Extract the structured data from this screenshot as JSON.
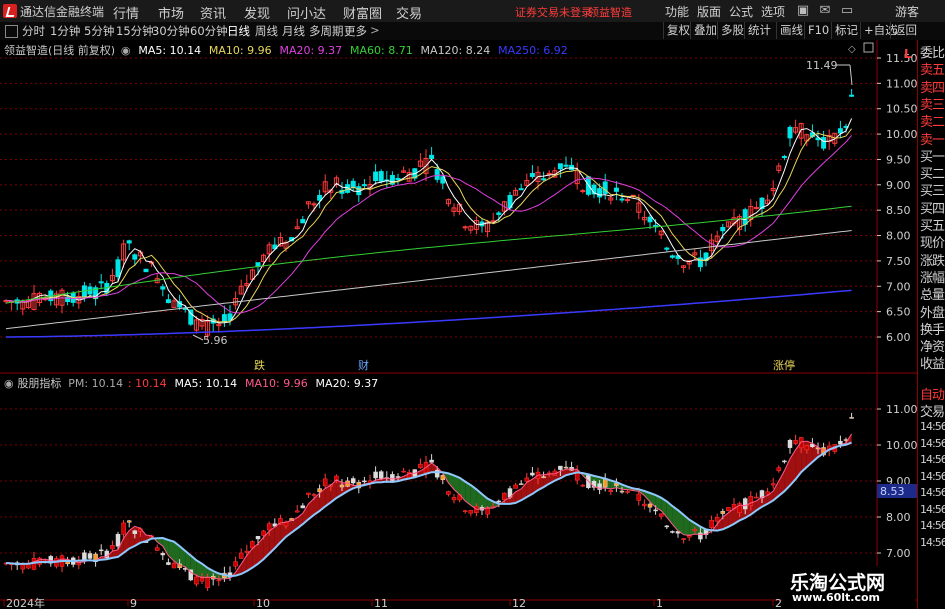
{
  "app": {
    "title": "通达信金融终端",
    "menu": [
      "行情",
      "市场",
      "资讯",
      "发现",
      "问小达",
      "财富圈",
      "交易"
    ],
    "warning": "证券交易未登录",
    "stock_link": "领益智造",
    "right_menu": [
      "功能",
      "版面",
      "公式",
      "选项"
    ],
    "user": "游客"
  },
  "timeframes": {
    "items": [
      "分时",
      "1分钟",
      "5分钟",
      "15分钟",
      "30分钟",
      "60分钟",
      "日线",
      "周线",
      "月线",
      "多周期",
      "更多"
    ],
    "active": "日线",
    "right_buttons": [
      "复权",
      "叠加",
      "多股",
      "统计",
      "画线",
      "F10",
      "标记",
      "+自选",
      "返回"
    ]
  },
  "main_chart": {
    "stock_label": "领益智造(日线 前复权)",
    "legend": [
      {
        "label": "MA5: 10.14",
        "color": "#ffffff"
      },
      {
        "label": "MA10: 9.96",
        "color": "#e8d65a"
      },
      {
        "label": "MA20: 9.37",
        "color": "#e040e0"
      },
      {
        "label": "MA60: 8.71",
        "color": "#35d035"
      },
      {
        "label": "MA120: 8.24",
        "color": "#c8c8c8"
      },
      {
        "label": "MA250: 6.92",
        "color": "#3a3aff"
      }
    ],
    "price_axis": [
      "11.50",
      "11.00",
      "10.50",
      "10.00",
      "9.50",
      "9.00",
      "8.50",
      "8.00",
      "7.50",
      "7.00",
      "6.50",
      "6.00"
    ],
    "high_label": "11.49",
    "low_label": "5.96",
    "event_labels": [
      "跌",
      "财",
      "涨停"
    ],
    "label_letter": "L"
  },
  "indicator": {
    "title": "股朋指标",
    "legend": [
      {
        "label": "PM: 10.14",
        "color": "#aaaaaa"
      },
      {
        "label": ": 10.14",
        "color": "#ff3b3b"
      },
      {
        "label": "MA5: 10.14",
        "color": "#ffffff"
      },
      {
        "label": "MA10: 9.96",
        "color": "#ff5a8a"
      },
      {
        "label": "MA20: 9.37",
        "color": "#ffffff"
      }
    ],
    "price_axis": [
      "11.00",
      "10.00",
      "9.00",
      "8.00",
      "7.00"
    ],
    "current_label": "8.53"
  },
  "sidebar": {
    "items": [
      "委比",
      "卖五",
      "卖四",
      "卖三",
      "卖二",
      "卖一",
      "买一",
      "买二",
      "买三",
      "买四",
      "买五",
      "现价",
      "涨跌",
      "涨幅",
      "总量",
      "外盘",
      "换手",
      "净资",
      "收益"
    ],
    "trade_items": [
      "自动",
      "交易"
    ],
    "times": [
      "14:56",
      "14:56",
      "14:56",
      "14:56",
      "14:56",
      "14:56",
      "14:56",
      "14:56"
    ]
  },
  "date_axis": [
    "2024年",
    "9",
    "10",
    "11",
    "12",
    "1",
    "2"
  ],
  "watermark": {
    "title": "乐淘公式网",
    "url": "www.60lt.com"
  },
  "colors": {
    "up": "#ff3b3b",
    "down": "#00e5e5",
    "bg": "#000000",
    "grid": "#7a0000",
    "accent": "#e8d65a"
  }
}
